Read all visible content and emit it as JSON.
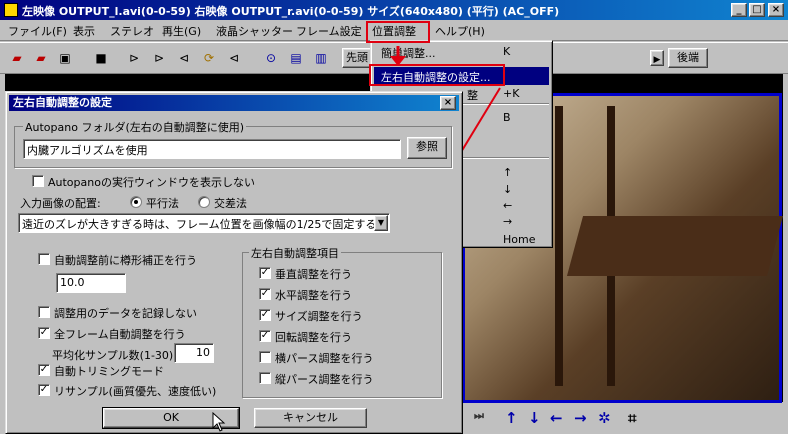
{
  "window": {
    "title": "左映像 OUTPUT_l.avi(0-0-59)  右映像 OUTPUT_r.avi(0-0-59)  サイズ(640x480) (平行) (AC_OFF)",
    "minimize": "_",
    "maximize": "□",
    "close": "×"
  },
  "menu": [
    {
      "label": "ファイル(F)"
    },
    {
      "label": "表示"
    },
    {
      "label": "ステレオ"
    },
    {
      "label": "再生(G)"
    },
    {
      "label": "液晶シャッター"
    },
    {
      "label": "フレーム設定"
    },
    {
      "label": "位置調整"
    },
    {
      "label": "ヘルプ(H)"
    }
  ],
  "toolbar": {
    "head_button": "先頭",
    "tail_button": "後端"
  },
  "dropdown": {
    "items": [
      {
        "label": "簡単調整...",
        "shortcut": "K"
      },
      {
        "label": "左右自動調整の設定...",
        "shortcut": ""
      },
      {
        "label": "",
        "shortcut": "+K"
      },
      {
        "label": "",
        "shortcut": "B"
      },
      {
        "label": "",
        "shortcut": "↑"
      },
      {
        "label": "",
        "shortcut": "↓"
      },
      {
        "label": "",
        "shortcut": "←"
      },
      {
        "label": "",
        "shortcut": "→"
      },
      {
        "label": "",
        "shortcut": "Home"
      }
    ],
    "partial_left": "整"
  },
  "dialog": {
    "title": "左右自動調整の設定",
    "close": "×",
    "autopano_group": "Autopano フォルダ(左右の自動調整に使用)",
    "path_value": "内臓アルゴリズムを使用",
    "browse_button": "参照",
    "show_window": "Autopanoの実行ウィンドウを表示しない",
    "layout_label": "入力画像の配置:",
    "parallel": "平行法",
    "cross": "交差法",
    "threshold_select": "遠近のズレが大きすぎる時は、フレーム位置を画像幅の1/25で固定する",
    "keystone": "自動調整前に樽形補正を行う",
    "keystone_value": "10.0",
    "record_data": "調整用のデータを記録しない",
    "all_frames": "全フレーム自動調整を行う",
    "samples_label": "平均化サンプル数(1-30):",
    "samples_value": "10",
    "auto_trim": "自動トリミングモード",
    "resample": "リサンプル(画質優先、速度低い)",
    "items_group": "左右自動調整項目",
    "items": [
      {
        "label": "垂直調整を行う",
        "checked": "✓"
      },
      {
        "label": "水平調整を行う",
        "checked": "✓"
      },
      {
        "label": "サイズ調整を行う",
        "checked": "✓"
      },
      {
        "label": "回転調整を行う",
        "checked": "✓"
      },
      {
        "label": "横パース調整を行う",
        "checked": ""
      },
      {
        "label": "縦パース調整を行う",
        "checked": ""
      }
    ],
    "ok": "OK",
    "cancel": "キャンセル"
  },
  "bottom": {
    "icons": [
      "⏭",
      "↑",
      "↓",
      "←",
      "→",
      "✲",
      "⌗"
    ]
  }
}
